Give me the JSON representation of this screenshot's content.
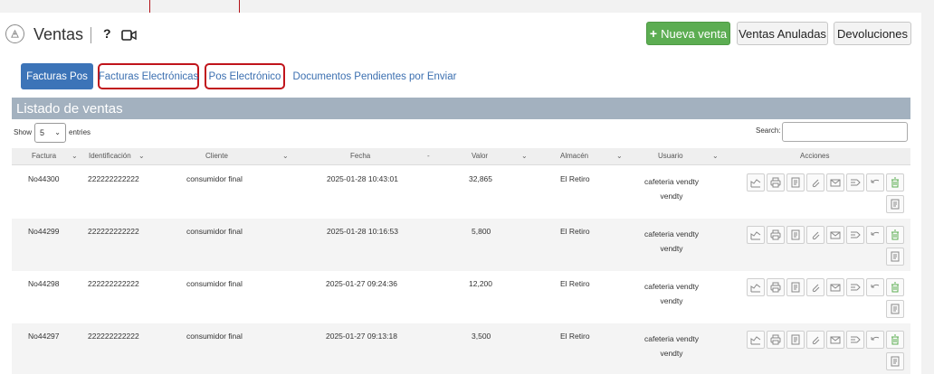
{
  "header": {
    "title": "Ventas",
    "help": "?",
    "buttons": {
      "nueva_venta": "Nueva venta",
      "ventas_anuladas": "Ventas Anuladas",
      "devoluciones": "Devoluciones"
    }
  },
  "tabs": [
    {
      "label": "Facturas Pos",
      "active": true
    },
    {
      "label": "Facturas Electrónicas",
      "outlined": true
    },
    {
      "label": "Pos Electrónico",
      "outlined": true
    },
    {
      "label": "Documentos Pendientes por Enviar"
    }
  ],
  "list": {
    "title": "Listado de ventas",
    "show_label": "Show",
    "entries_value": "5",
    "entries_label": "entries",
    "search_label": "Search:",
    "search_value": ""
  },
  "table": {
    "columns": [
      "Factura",
      "Identificación",
      "Cliente",
      "Fecha",
      "Valor",
      "Almacén",
      "Usuario",
      "Acciones"
    ],
    "rows": [
      {
        "factura": "No44300",
        "identificacion": "222222222222",
        "cliente": "consumidor final",
        "fecha": "2025-01-28 10:43:01",
        "valor": "32,865",
        "almacen": "El Retiro",
        "usuario_1": "cafeteria vendty",
        "usuario_2": "vendty"
      },
      {
        "factura": "No44299",
        "identificacion": "222222222222",
        "cliente": "consumidor final",
        "fecha": "2025-01-28 10:16:53",
        "valor": "5,800",
        "almacen": "El Retiro",
        "usuario_1": "cafeteria vendty",
        "usuario_2": "vendty"
      },
      {
        "factura": "No44298",
        "identificacion": "222222222222",
        "cliente": "consumidor final",
        "fecha": "2025-01-27 09:24:36",
        "valor": "12,200",
        "almacen": "El Retiro",
        "usuario_1": "cafeteria vendty",
        "usuario_2": "vendty"
      },
      {
        "factura": "No44297",
        "identificacion": "222222222222",
        "cliente": "consumidor final",
        "fecha": "2025-01-27 09:13:18",
        "valor": "3,500",
        "almacen": "El Retiro",
        "usuario_1": "cafeteria vendty",
        "usuario_2": "vendty"
      }
    ]
  },
  "colors": {
    "accent": "#3c74b8",
    "green": "#5cad52",
    "highlight": "#c0141b",
    "list_bar": "#a3b1bf"
  },
  "action_icons": [
    "chart-icon",
    "print-icon",
    "document-icon",
    "attach-icon",
    "email-icon",
    "send-icon",
    "undo-icon",
    "trash-icon",
    "document-icon"
  ]
}
